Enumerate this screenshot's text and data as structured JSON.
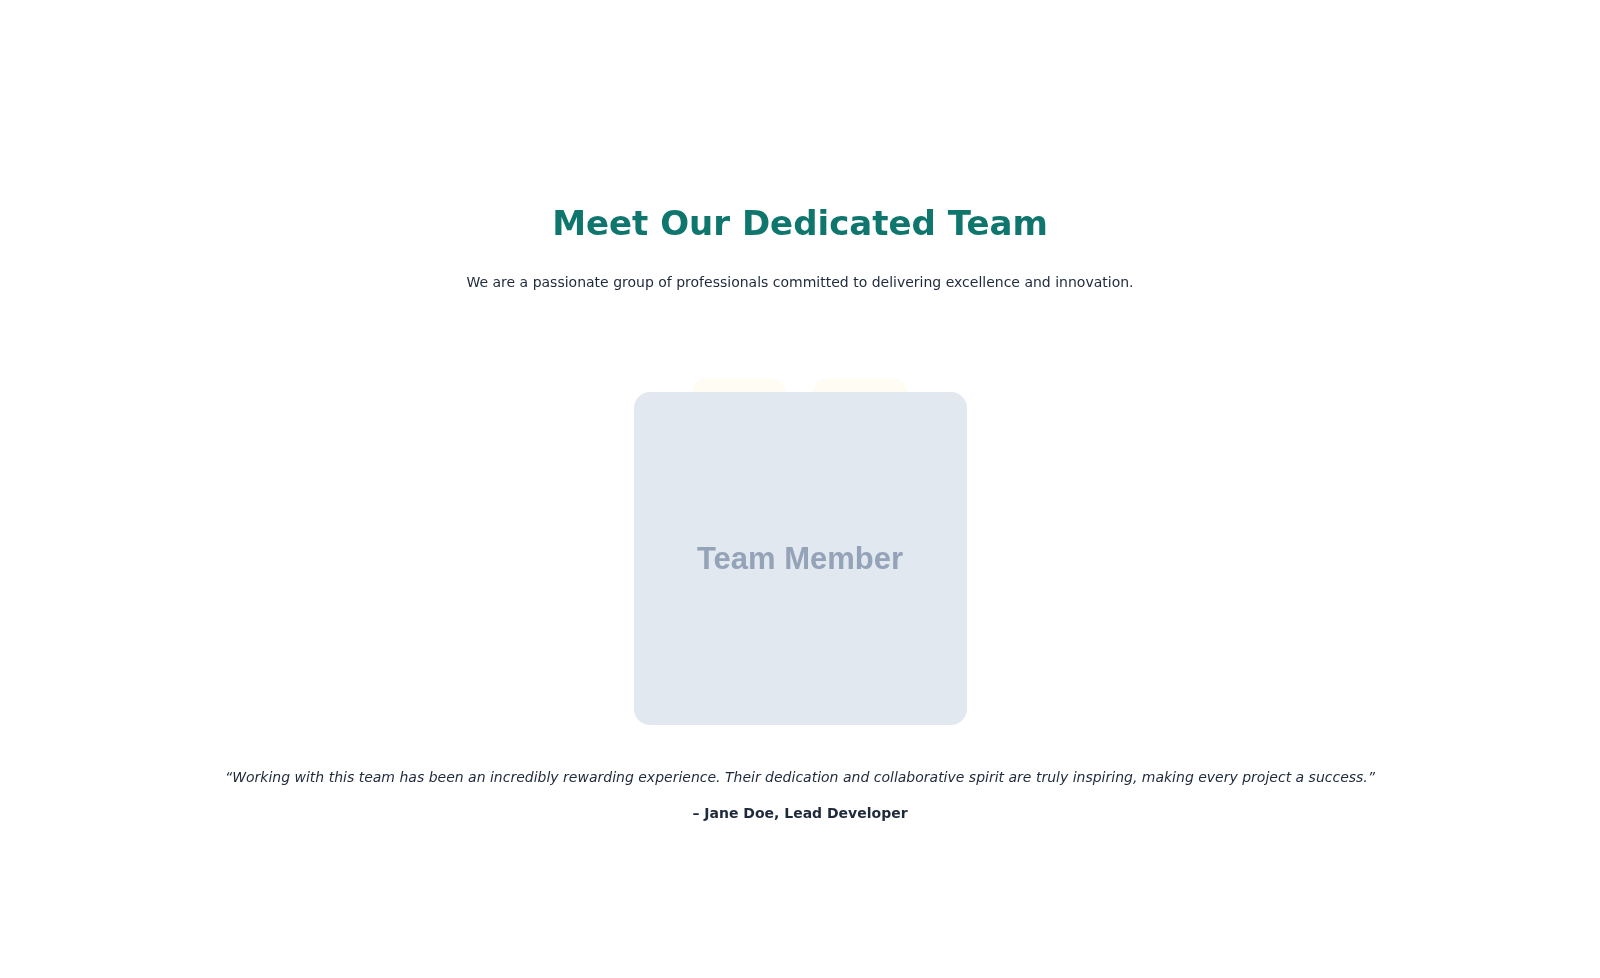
{
  "heading": "Meet Our Dedicated Team",
  "intro": "We are a passionate group of professionals committed to delivering excellence and innovation.",
  "member_card": {
    "label": "Team Member"
  },
  "testimonial": {
    "quote": "“Working with this team has been an incredibly rewarding experience. Their dedication and collaborative spirit are truly inspiring, making every project a success.”",
    "author": "– Jane Doe, Lead Developer"
  }
}
